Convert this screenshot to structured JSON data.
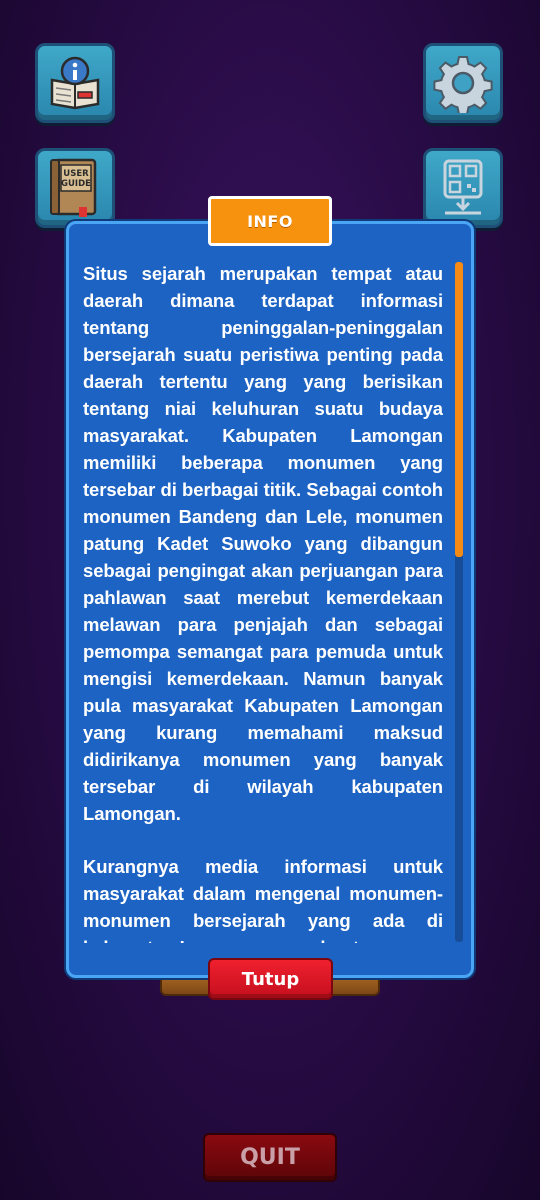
{
  "menu": {
    "info_icon": "info-book-icon",
    "settings_icon": "gear-icon",
    "guide_icon": "user-guide-book-icon",
    "guide_label_line1": "USER",
    "guide_label_line2": "GUIDE",
    "qr_icon": "qr-download-icon",
    "quit_label": "QUIT"
  },
  "info_modal": {
    "title": "INFO",
    "paragraphs": [
      "Situs sejarah merupakan tempat atau daerah dimana terdapat informasi tentang peninggalan-peninggalan bersejarah suatu peristiwa penting pada daerah tertentu yang yang berisikan tentang niai keluhuran suatu budaya masyarakat. Kabupaten Lamongan memiliki beberapa monumen yang tersebar di berbagai titik. Sebagai contoh monumen Bandeng dan Lele, monumen patung Kadet Suwoko yang dibangun sebagai pengingat akan perjuangan para pahlawan saat merebut kemerdekaan melawan para penjajah dan sebagai pemompa semangat para pemuda untuk mengisi kemerdekaan. Namun banyak pula masyarakat Kabupaten Lamongan yang kurang memahami maksud didirikanya monumen yang banyak tersebar di wilayah kabupaten Lamongan.",
      "Kurangnya media informasi untuk masyarakat dalam mengenal monumen-monumen bersejarah yang ada di kabupaten Lamongan membuat"
    ],
    "close_label": "Tutup",
    "scroll_position": 0.0
  },
  "colors": {
    "modal_bg": "#1d63c4",
    "accent_orange": "#f7920e",
    "close_red": "#e01826"
  }
}
